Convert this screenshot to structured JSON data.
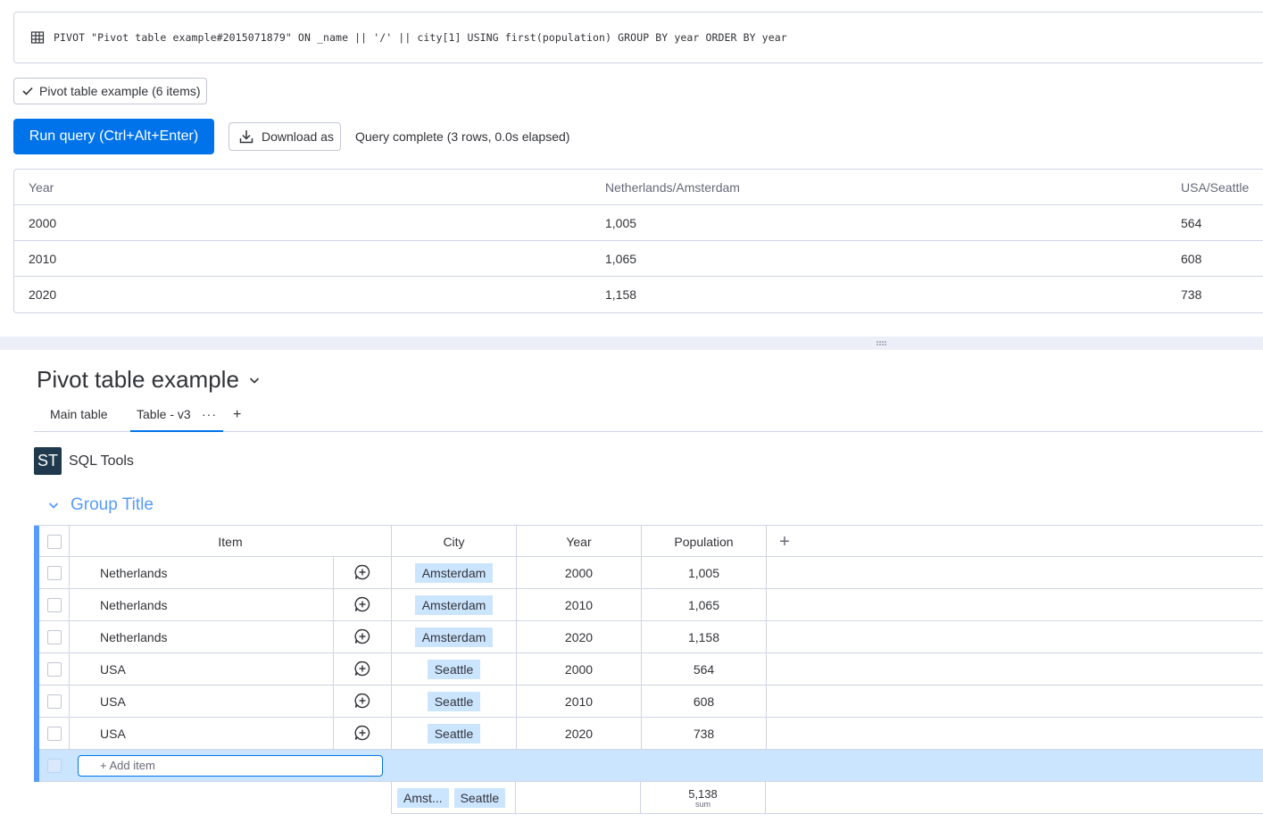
{
  "query": {
    "text": "PIVOT \"Pivot table example#2015071879\" ON _name || '/' || city[1] USING first(population) GROUP BY year ORDER BY year",
    "icon": "table-grid-icon"
  },
  "board_chip": {
    "label": "Pivot table example (6 items)",
    "icon": "check-icon"
  },
  "toolbar": {
    "run_label": "Run query (Ctrl+Alt+Enter)",
    "download_label": "Download as",
    "status": "Query complete (3 rows, 0.0s elapsed)"
  },
  "result": {
    "columns": [
      "Year",
      "Netherlands/Amsterdam",
      "USA/Seattle"
    ],
    "rows": [
      [
        "2000",
        "1,005",
        "564"
      ],
      [
        "2010",
        "1,065",
        "608"
      ],
      [
        "2020",
        "1,158",
        "738"
      ]
    ]
  },
  "board": {
    "title": "Pivot table example",
    "views": {
      "main": "Main table",
      "active": "Table - v3",
      "dots": "···",
      "add": "+"
    },
    "app": {
      "logo": "ST",
      "name": "SQL Tools"
    },
    "group_title": "Group Title",
    "accent": "#579bfc",
    "columns": {
      "item": "Item",
      "city": "City",
      "year": "Year",
      "population": "Population",
      "add": "+"
    },
    "rows": [
      {
        "item": "Netherlands",
        "city": "Amsterdam",
        "year": "2000",
        "population": "1,005"
      },
      {
        "item": "Netherlands",
        "city": "Amsterdam",
        "year": "2010",
        "population": "1,065"
      },
      {
        "item": "Netherlands",
        "city": "Amsterdam",
        "year": "2020",
        "population": "1,158"
      },
      {
        "item": "USA",
        "city": "Seattle",
        "year": "2000",
        "population": "564"
      },
      {
        "item": "USA",
        "city": "Seattle",
        "year": "2010",
        "population": "608"
      },
      {
        "item": "USA",
        "city": "Seattle",
        "year": "2020",
        "population": "738"
      }
    ],
    "add_item": "+ Add item",
    "summary": {
      "city_tags": [
        "Amst...",
        "Seattle"
      ],
      "population": "5,138",
      "population_label": "sum"
    }
  }
}
